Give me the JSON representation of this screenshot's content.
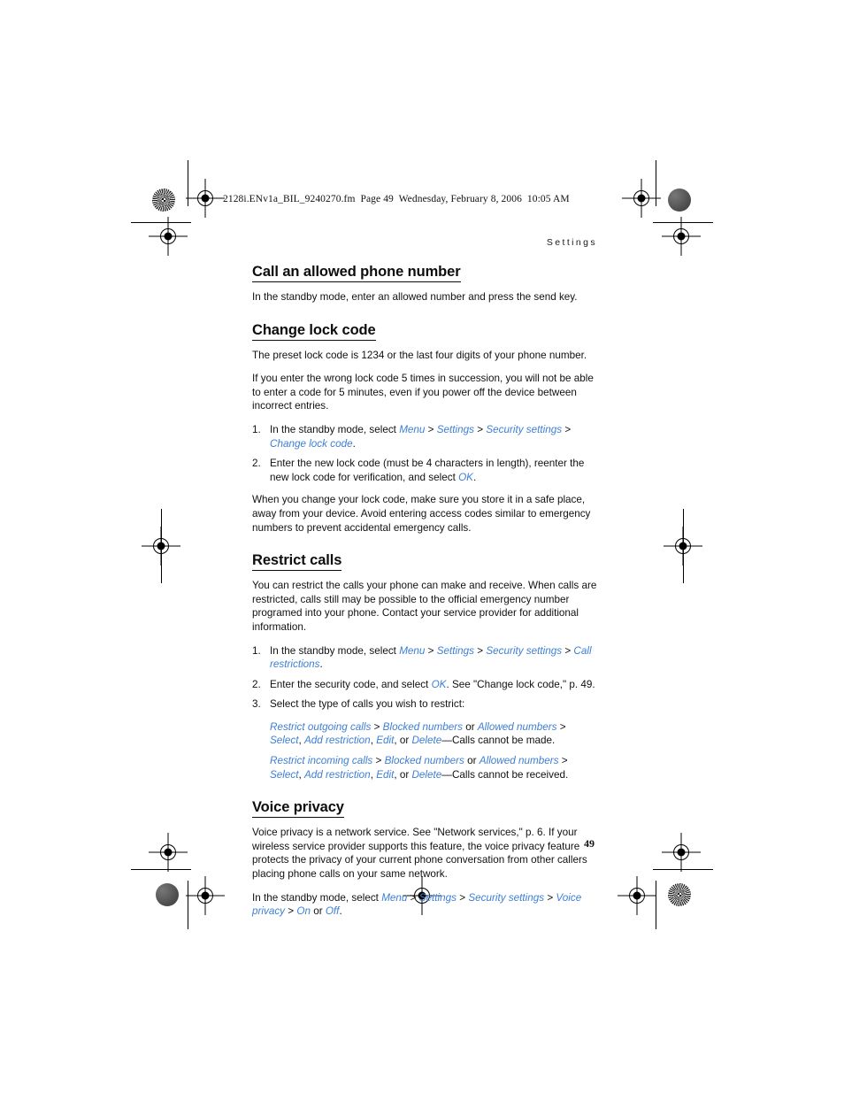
{
  "page": {
    "slug_line": "2128i.ENv1a_BIL_9240270.fm  Page 49  Wednesday, February 8, 2006  10:05 AM",
    "running_head": "Settings",
    "page_number": "49",
    "link_color": "#3d7fd6",
    "text_color": "#111111"
  },
  "sections": [
    {
      "title": "Call an allowed phone number",
      "paragraph": "In the standby mode, enter an allowed number and press the send key."
    },
    {
      "title": "Change lock code",
      "paragraph_1": "The preset lock code is 1234 or the last four digits of your phone number.",
      "paragraph_2": "If you enter the wrong lock code 5 times in succession, you will not be able to enter a code for 5 minutes, even if you power off the device between incorrect entries.",
      "step_1": {
        "lead": "In the standby mode, select ",
        "menu": "Menu",
        "sep_1": " > ",
        "settings": "Settings",
        "sep_2": " > ",
        "security_settings": "Security settings",
        "sep_3": " > ",
        "change_lock_code": "Change lock code",
        "period": "."
      },
      "step_2": {
        "lead": "Enter the new lock code (must be 4 characters in length), reenter the new lock code for verification, and select ",
        "ok": "OK",
        "period": "."
      },
      "paragraph_3": "When you change your lock code, make sure you store it in a safe place, away from your device. Avoid entering access codes similar to emergency numbers to prevent accidental emergency calls."
    },
    {
      "title": "Restrict calls",
      "paragraph_1": "You can restrict the calls your phone can make and receive. When calls are restricted, calls still may be possible to the official emergency number programed into your phone. Contact your service provider for additional information.",
      "step_1": {
        "lead": "In the standby mode, select ",
        "menu": "Menu",
        "sep_1": " > ",
        "settings": "Settings",
        "sep_2": " > ",
        "security_settings": "Security settings",
        "sep_3": " > ",
        "call_restrictions": "Call restrictions",
        "period": "."
      },
      "step_2": {
        "lead": "Enter the security code, and select ",
        "ok": "OK",
        "tail": ". See \"Change lock code,\" p. 49."
      },
      "step_3": "Select the type of calls you wish to restrict:",
      "outgoing": {
        "restrict": "Restrict outgoing calls",
        "sep_1": " > ",
        "blocked": "Blocked numbers",
        "sep_or": " or ",
        "allowed": "Allowed numbers",
        "sep_2": " > ",
        "select": "Select",
        "comma_1": ", ",
        "add_restriction": "Add restriction",
        "comma_2": ", ",
        "edit": "Edit",
        "comma_or": ", or ",
        "delete": "Delete",
        "tail": "—Calls cannot be made."
      },
      "incoming": {
        "restrict": "Restrict incoming calls",
        "sep_1": " > ",
        "blocked": "Blocked numbers",
        "sep_or": " or ",
        "allowed": "Allowed numbers",
        "sep_2": " > ",
        "select": "Select",
        "comma_1": ", ",
        "add_restriction": "Add restriction",
        "comma_2": ", ",
        "edit": "Edit",
        "comma_or": ", or ",
        "delete": "Delete",
        "tail": "—Calls cannot be received."
      }
    },
    {
      "title": "Voice privacy",
      "paragraph_1": "Voice privacy is a network service. See \"Network services,\" p. 6. If your wireless service provider supports this feature, the voice privacy feature protects the privacy of your current phone conversation from other callers placing phone calls on your same network.",
      "final": {
        "lead": "In the standby mode, select ",
        "menu": "Menu",
        "sep_1": " > ",
        "settings": "Settings",
        "sep_2": " > ",
        "security_settings": "Security settings",
        "sep_3": " > ",
        "voice_privacy": "Voice privacy",
        "sep_4": " > ",
        "on": "On",
        "sep_or": " or ",
        "off": "Off",
        "period": "."
      }
    }
  ]
}
